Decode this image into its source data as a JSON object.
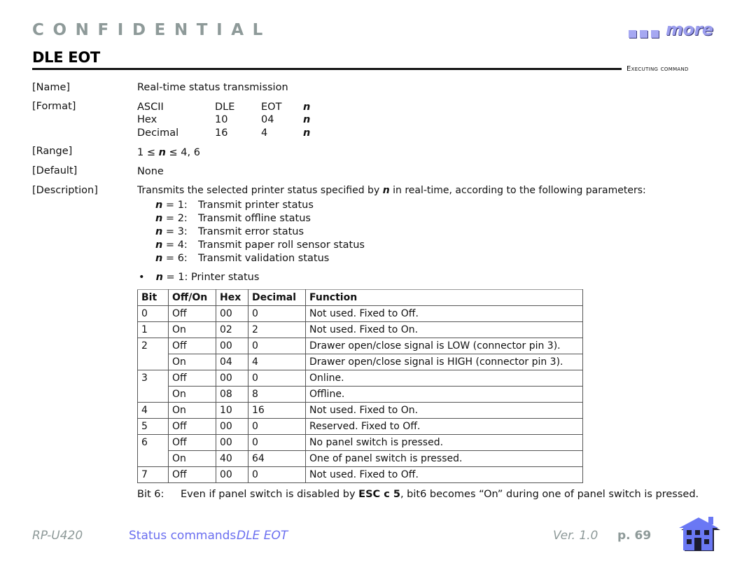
{
  "header": {
    "confidential": "CONFIDENTIAL",
    "more_link": "more",
    "title": "DLE EOT",
    "section": "Executing command"
  },
  "entries": {
    "name": {
      "label": "[Name]",
      "value": "Real-time status transmission"
    },
    "format": {
      "label": "[Format]",
      "rows": [
        {
          "kind": "ASCII",
          "b1": "DLE",
          "b2": "EOT",
          "p": "n"
        },
        {
          "kind": "Hex",
          "b1": "10",
          "b2": "04",
          "p": "n"
        },
        {
          "kind": "Decimal",
          "b1": "16",
          "b2": "4",
          "p": "n"
        }
      ]
    },
    "range": {
      "label": "[Range]",
      "pre": "1 ≤ ",
      "n": "n",
      "post": " ≤ 4, 6"
    },
    "default": {
      "label": "[Default]",
      "value": "None"
    },
    "description": {
      "label": "[Description]",
      "intro_pre": "Transmits the selected printer status specified by ",
      "intro_n": "n",
      "intro_post": " in real-time, according to the following parameters:",
      "params": [
        {
          "n": "n",
          "key": " = 1:",
          "text": "Transmit printer status"
        },
        {
          "n": "n",
          "key": " = 2:",
          "text": "Transmit offline status"
        },
        {
          "n": "n",
          "key": " = 3:",
          "text": "Transmit error status"
        },
        {
          "n": "n",
          "key": " = 4:",
          "text": "Transmit paper roll sensor status"
        },
        {
          "n": "n",
          "key": " = 6:",
          "text": "Transmit validation status"
        }
      ],
      "bullet": "•",
      "bullet_n": "n",
      "bullet_text": " = 1: Printer status"
    }
  },
  "table": {
    "headers": [
      "Bit",
      "Off/On",
      "Hex",
      "Decimal",
      "Function"
    ],
    "rows": [
      {
        "bit": "0",
        "state": "Off",
        "hex": "00",
        "dec": "0",
        "fn": "Not used. Fixed to Off."
      },
      {
        "bit": "1",
        "state": "On",
        "hex": "02",
        "dec": "2",
        "fn": "Not used. Fixed to On."
      },
      {
        "bit": "2",
        "state": "Off",
        "hex": "00",
        "dec": "0",
        "fn": "Drawer open/close signal is LOW (connector pin 3)."
      },
      {
        "bit": "",
        "state": "On",
        "hex": "04",
        "dec": "4",
        "fn": "Drawer open/close signal is HIGH (connector pin 3)."
      },
      {
        "bit": "3",
        "state": "Off",
        "hex": "00",
        "dec": "0",
        "fn": "Online."
      },
      {
        "bit": "",
        "state": "On",
        "hex": "08",
        "dec": "8",
        "fn": "Offline."
      },
      {
        "bit": "4",
        "state": "On",
        "hex": "10",
        "dec": "16",
        "fn": "Not used. Fixed to On."
      },
      {
        "bit": "5",
        "state": "Off",
        "hex": "00",
        "dec": "0",
        "fn": "Reserved. Fixed to Off."
      },
      {
        "bit": "6",
        "state": "Off",
        "hex": "00",
        "dec": "0",
        "fn": "No panel switch is pressed."
      },
      {
        "bit": "",
        "state": "On",
        "hex": "40",
        "dec": "64",
        "fn": "One of panel switch is pressed."
      },
      {
        "bit": "7",
        "state": "Off",
        "hex": "00",
        "dec": "0",
        "fn": "Not used. Fixed to Off."
      }
    ]
  },
  "note": {
    "key": "Bit 6:",
    "pre": "Even if panel switch is disabled by ",
    "cmd": "ESC c 5",
    "post": ", bit6 becomes “On” during one of panel switch is pressed."
  },
  "footer": {
    "model": "RP-U420",
    "section_link": "Status commands",
    "command_link": "DLE EOT",
    "version": "Ver. 1.0",
    "page": "p. 69",
    "home_icon": "home-icon"
  },
  "colors": {
    "gray": "#8e9a99",
    "link_blue": "#6b6ff0",
    "home_blue": "#6a78f4"
  }
}
